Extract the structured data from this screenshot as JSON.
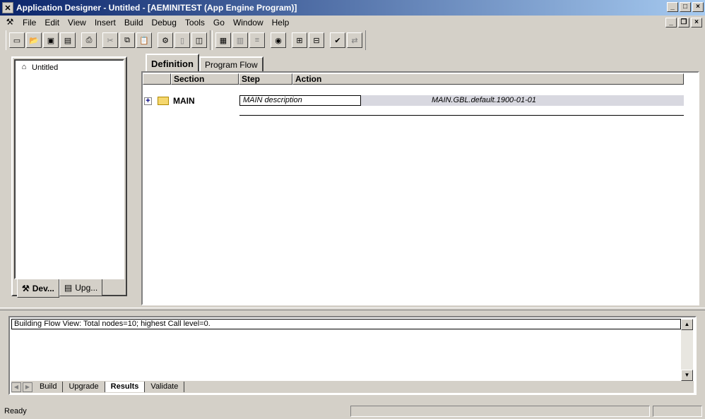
{
  "window": {
    "title": "Application Designer - Untitled - [AEMINITEST (App Engine Program)]",
    "controls": [
      "_",
      "□",
      "×"
    ]
  },
  "menu": {
    "items": [
      {
        "label": "File",
        "key": "F"
      },
      {
        "label": "Edit",
        "key": "E"
      },
      {
        "label": "View",
        "key": "V"
      },
      {
        "label": "Insert",
        "key": "I"
      },
      {
        "label": "Build",
        "key": "B"
      },
      {
        "label": "Debug",
        "key": "D"
      },
      {
        "label": "Tools",
        "key": "T"
      },
      {
        "label": "Go",
        "key": "G"
      },
      {
        "label": "Window",
        "key": "W"
      },
      {
        "label": "Help",
        "key": "H"
      }
    ],
    "mdi_controls": [
      "_",
      "❐",
      "×"
    ]
  },
  "toolbar": {
    "icons": [
      "new-icon",
      "open-icon",
      "save-icon",
      "save-all-icon",
      "print-icon",
      "cut-icon",
      "copy-icon",
      "paste-icon",
      "properties-icon",
      "find-icon",
      "view-icon",
      "section-icon",
      "step-icon",
      "sql-icon",
      "peoplecode-icon",
      "insert-step-icon",
      "delete-step-icon",
      "validate-icon",
      "compare-icon"
    ]
  },
  "project": {
    "root": "Untitled",
    "tabs": [
      "Dev...",
      "Upg..."
    ]
  },
  "main": {
    "tabs": [
      "Definition",
      "Program Flow"
    ],
    "columns": [
      "Section",
      "Step",
      "Action"
    ],
    "section": {
      "expander": "+",
      "name": "MAIN",
      "description": "MAIN description",
      "details": "MAIN.GBL.default.1900-01-01"
    }
  },
  "output": {
    "message": "Building Flow View: Total nodes=10; highest Call level=0.",
    "tabs": [
      "Build",
      "Upgrade",
      "Results",
      "Validate"
    ],
    "active_tab": "Results"
  },
  "status": {
    "text": "Ready"
  }
}
